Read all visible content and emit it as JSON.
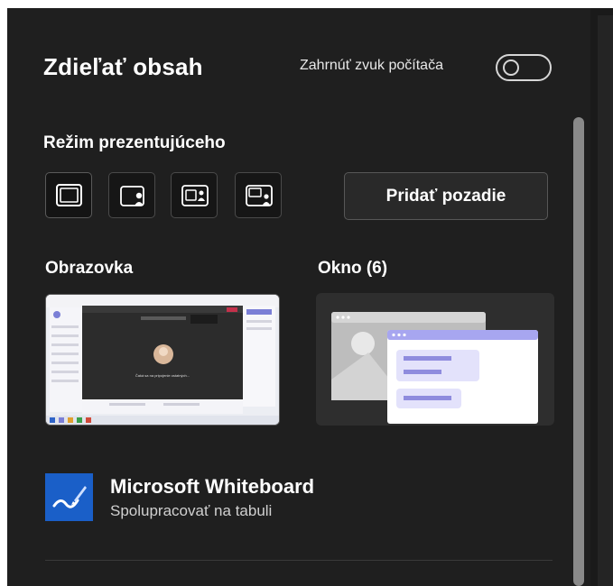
{
  "panel": {
    "title": "Zdieľať obsah",
    "include_audio_label": "Zahrnúť zvuk počítača",
    "include_audio_on": false
  },
  "presenter_mode": {
    "label": "Režim prezentujúceho",
    "modes": [
      {
        "icon": "content-only-icon",
        "selected": true
      },
      {
        "icon": "standout-icon",
        "selected": false
      },
      {
        "icon": "side-by-side-icon",
        "selected": false
      },
      {
        "icon": "reporter-icon",
        "selected": false
      }
    ],
    "background_button": "Pridať pozadie"
  },
  "sources": {
    "screen_label": "Obrazovka",
    "window_label": "Okno (6)",
    "screen_preview_text": "Čaká sa na pripojenie ostatných..."
  },
  "whiteboard": {
    "name": "Microsoft Whiteboard",
    "description": "Spolupracovať na tabuli",
    "icon_color": "#1a5fc8"
  },
  "colors": {
    "background": "#1f1f1f",
    "text": "#ffffff",
    "accent": "#7b7fd6"
  }
}
